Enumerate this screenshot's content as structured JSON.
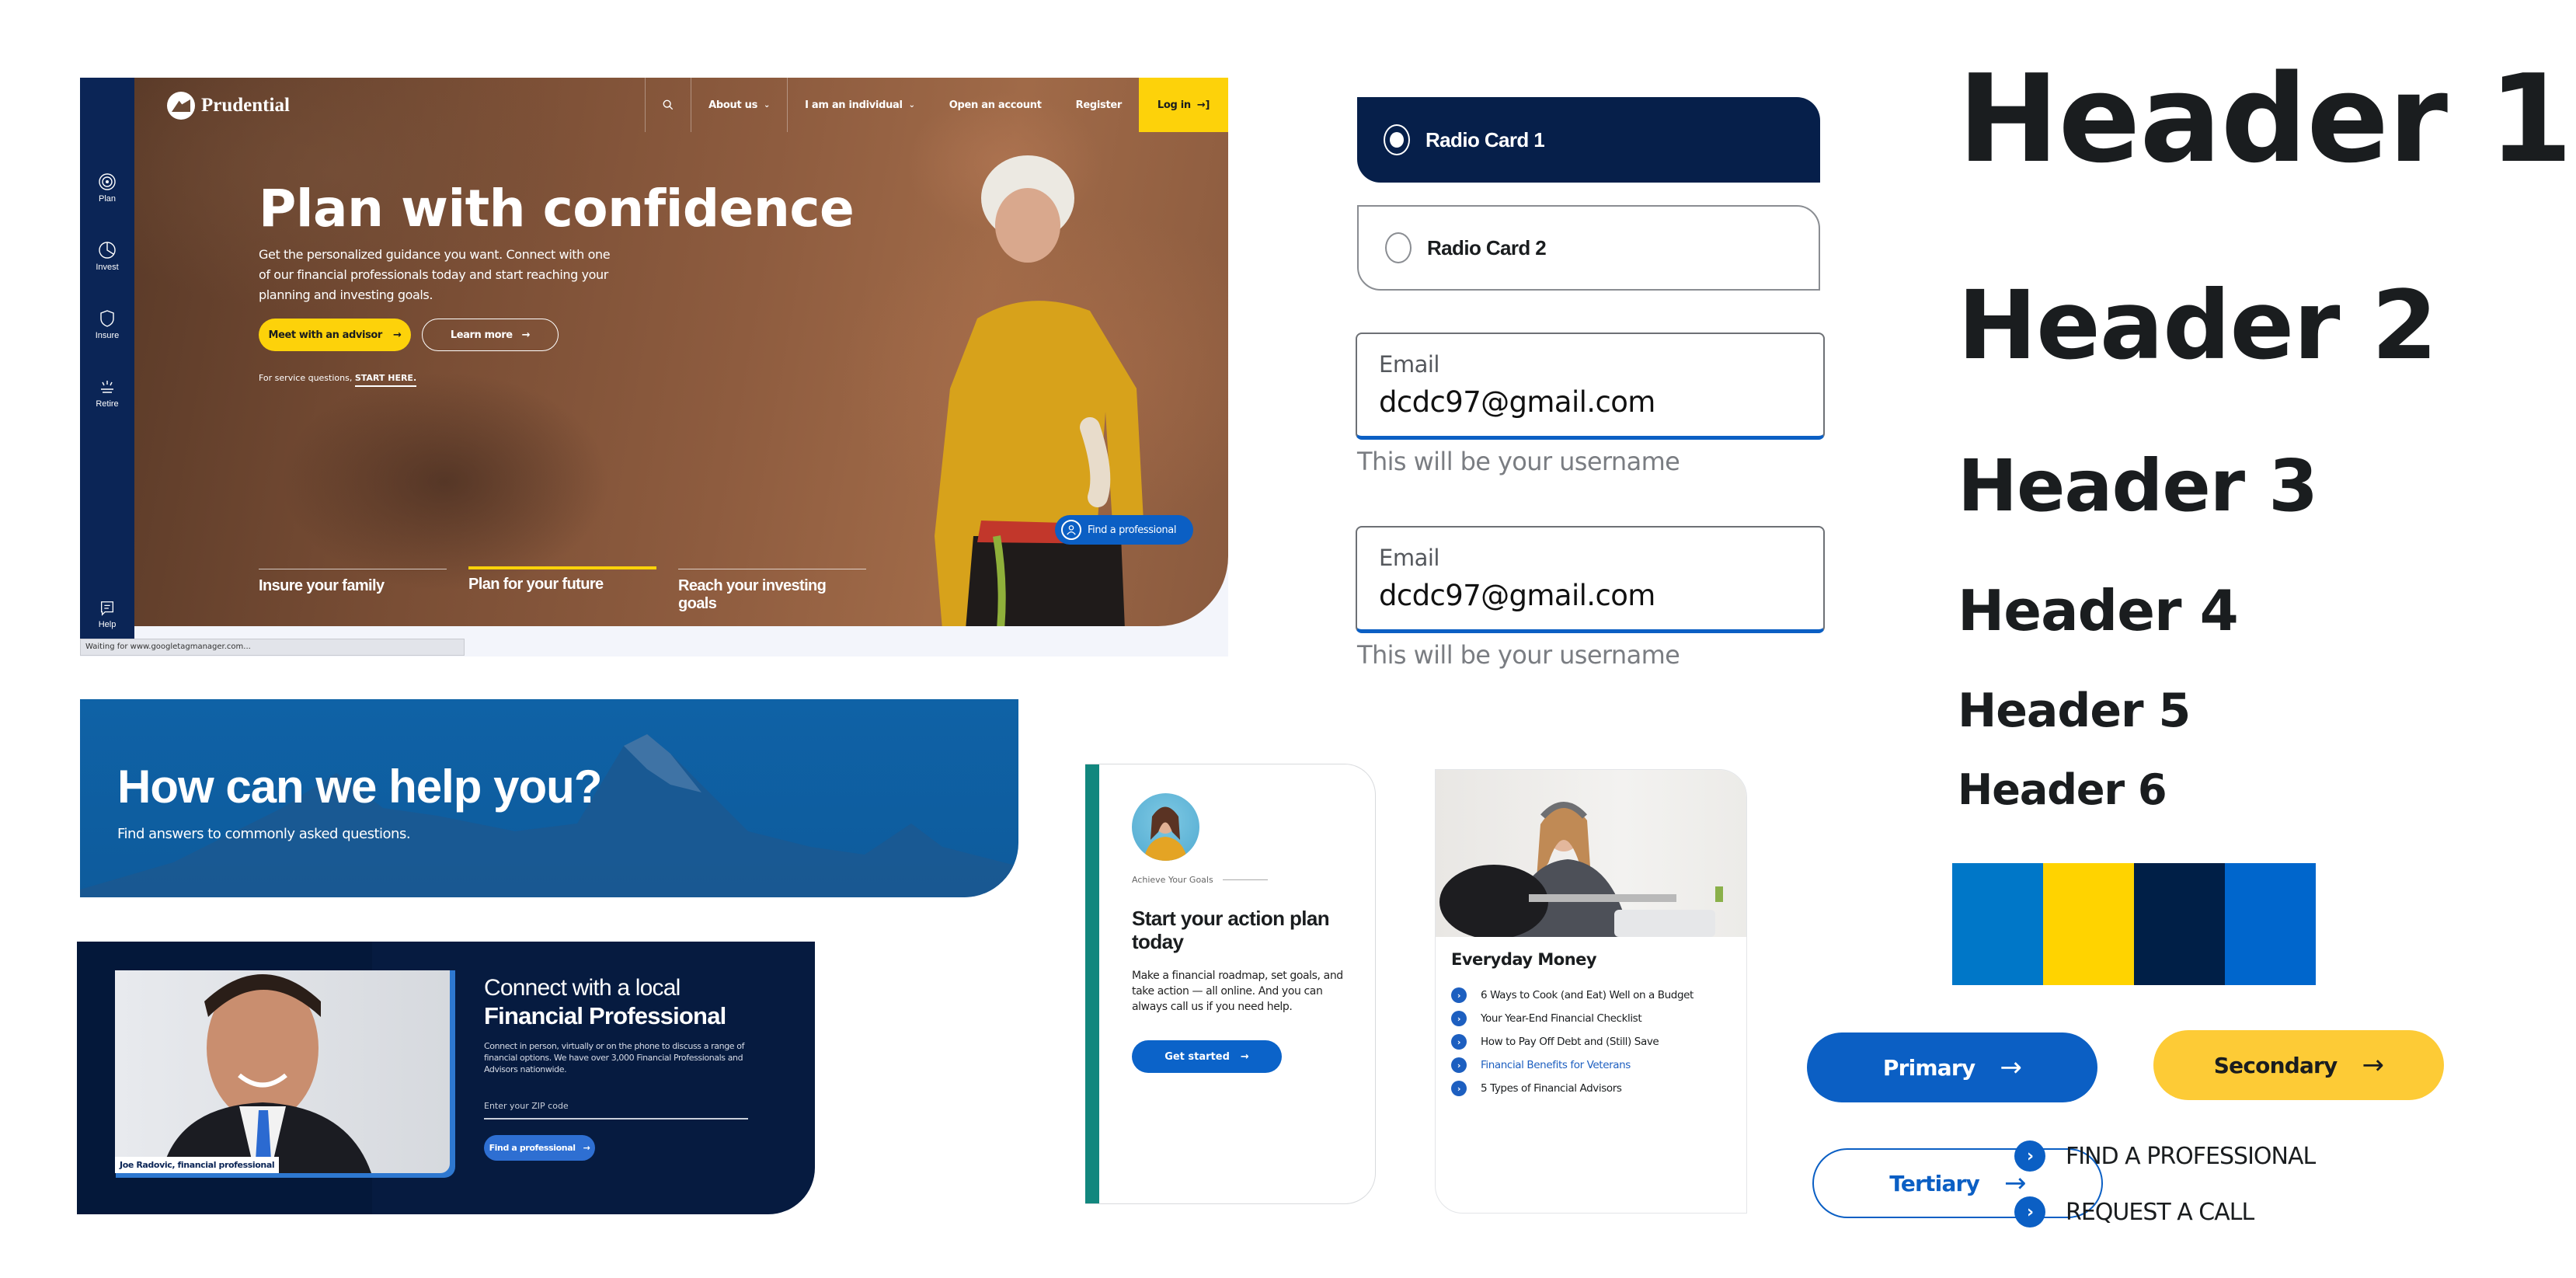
{
  "hero": {
    "brand": "Prudential",
    "nav": {
      "search_icon": "search-icon",
      "items": [
        {
          "label": "About us",
          "has_dropdown": true
        },
        {
          "label": "I am an individual",
          "has_dropdown": true
        },
        {
          "label": "Open an account",
          "has_dropdown": false
        },
        {
          "label": "Register",
          "has_dropdown": false
        }
      ],
      "login_label": "Log in",
      "login_icon": "login-arrow-icon"
    },
    "sidebar": [
      {
        "label": "Plan",
        "icon": "target-icon"
      },
      {
        "label": "Invest",
        "icon": "pie-chart-icon"
      },
      {
        "label": "Insure",
        "icon": "shield-icon"
      },
      {
        "label": "Retire",
        "icon": "sunrise-icon"
      },
      {
        "label": "Help",
        "icon": "chat-icon"
      }
    ],
    "title": "Plan with confidence",
    "subtitle": "Get the personalized guidance you want. Connect with one of our financial professionals today and start reaching your planning and investing goals.",
    "primary_cta": "Meet with an advisor",
    "secondary_cta": "Learn more",
    "service_prefix": "For service questions, ",
    "service_link": "START HERE.",
    "tabs": [
      {
        "label": "Insure your family",
        "active": false
      },
      {
        "label": "Plan for your future",
        "active": true
      },
      {
        "label": "Reach your investing goals",
        "active": false
      }
    ],
    "find_pro": "Find a professional",
    "status_text": "Waiting for www.googletagmanager.com..."
  },
  "radio_cards": [
    {
      "label": "Radio Card 1",
      "selected": true
    },
    {
      "label": "Radio Card 2",
      "selected": false
    }
  ],
  "email_fields": [
    {
      "label": "Email",
      "value": "dcdc97@gmail.com",
      "help": "This will be your username"
    },
    {
      "label": "Email",
      "value": "dcdc97@gmail.com",
      "help": "This will be your username"
    }
  ],
  "headers": [
    "Header 1",
    "Header 2",
    "Header 3",
    "Header 4",
    "Header 5",
    "Header 6"
  ],
  "palette": [
    "#0077c8",
    "#ffd300",
    "#001f47",
    "#0066cc"
  ],
  "buttons": {
    "primary": "Primary",
    "secondary": "Secondary",
    "tertiary": "Tertiary",
    "links": [
      "FIND A PROFESSIONAL",
      "REQUEST A CALL"
    ]
  },
  "help_banner": {
    "title": "How can we help you?",
    "subtitle": "Find answers to commonly asked questions."
  },
  "connect": {
    "title_line1": "Connect with a local",
    "title_line2": "Financial Professional",
    "description": "Connect in person, virtually or on the phone to discuss a range of financial options. We have over 3,000 Financial Professionals and Advisors nationwide.",
    "zip_placeholder": "Enter your ZIP code",
    "zip_value": "",
    "button": "Find a professional",
    "photo_caption": "Joe Radovic, financial professional"
  },
  "action_card": {
    "eyebrow": "Achieve Your Goals",
    "title": "Start your action plan today",
    "description": "Make a financial roadmap, set goals, and take action — all online. And you can always call us if you need help.",
    "button": "Get started"
  },
  "money_card": {
    "title": "Everyday Money",
    "items": [
      {
        "label": "6 Ways to Cook (and Eat) Well on a Budget",
        "highlight": false
      },
      {
        "label": "Your Year-End Financial Checklist",
        "highlight": false
      },
      {
        "label": "How to Pay Off Debt and (Still) Save",
        "highlight": false
      },
      {
        "label": "Financial Benefits for Veterans",
        "highlight": true
      },
      {
        "label": "5 Types of Financial Advisors",
        "highlight": false
      }
    ]
  }
}
